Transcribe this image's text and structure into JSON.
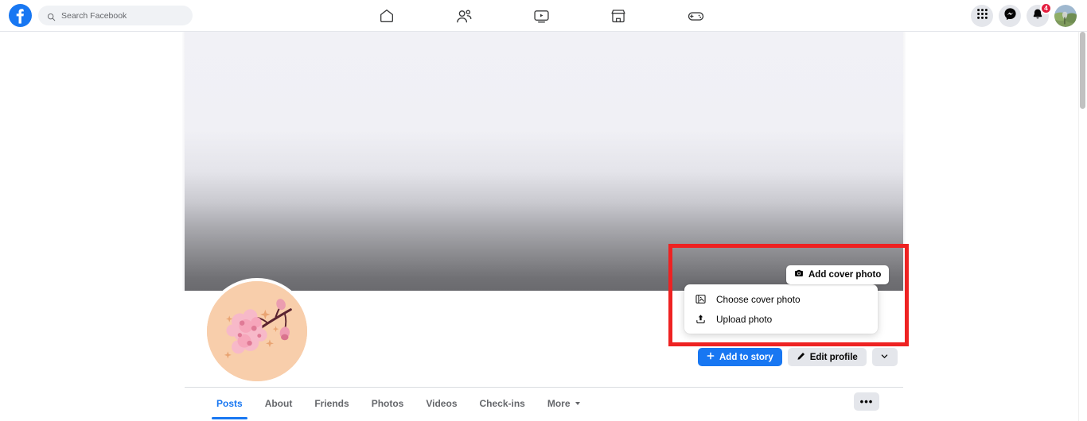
{
  "topbar": {
    "logo_name": "facebook-logo",
    "search": {
      "placeholder": "Search Facebook",
      "value": "",
      "icon": "search-icon"
    },
    "nav_tabs": [
      {
        "name": "home",
        "icon": "home-icon",
        "label": "Home"
      },
      {
        "name": "friends",
        "icon": "friends-icon",
        "label": "Friends"
      },
      {
        "name": "video",
        "icon": "video-icon",
        "label": "Video"
      },
      {
        "name": "marketplace",
        "icon": "marketplace-icon",
        "label": "Marketplace"
      },
      {
        "name": "gaming",
        "icon": "gaming-icon",
        "label": "Gaming"
      }
    ],
    "right_actions": [
      {
        "name": "menu",
        "icon": "grid-menu-icon"
      },
      {
        "name": "messenger",
        "icon": "messenger-icon"
      },
      {
        "name": "notifications",
        "icon": "bell-icon",
        "badge": "4"
      },
      {
        "name": "account",
        "icon": "avatar"
      }
    ]
  },
  "cover": {
    "name": "cover-photo-placeholder",
    "add_cover_button": {
      "label": "Add cover photo",
      "icon": "camera-icon"
    },
    "dropdown": {
      "items": [
        {
          "label": "Choose cover photo",
          "icon": "photo-frame-icon"
        },
        {
          "label": "Upload photo",
          "icon": "upload-icon"
        }
      ]
    }
  },
  "profile": {
    "avatar_name": "profile-picture",
    "avatar_alt": "cherry blossom illustration",
    "avatar_bg": "#f8ceab"
  },
  "actions": {
    "add_to_story": {
      "label": "Add to story",
      "icon": "plus-icon"
    },
    "edit_profile": {
      "label": "Edit profile",
      "icon": "pencil-icon"
    },
    "more_dropdown": {
      "icon": "chevron-down-icon"
    }
  },
  "tabs": {
    "items": [
      {
        "label": "Posts",
        "active": true
      },
      {
        "label": "About",
        "active": false
      },
      {
        "label": "Friends",
        "active": false
      },
      {
        "label": "Photos",
        "active": false
      },
      {
        "label": "Videos",
        "active": false
      },
      {
        "label": "Check-ins",
        "active": false
      },
      {
        "label": "More",
        "active": false,
        "has_caret": true
      }
    ],
    "overflow_button": {
      "label": "•••"
    }
  },
  "colors": {
    "accent": "#1877f2",
    "highlight": "#ee2222",
    "badge": "#e41e3f",
    "button_bg": "#e4e6eb"
  }
}
